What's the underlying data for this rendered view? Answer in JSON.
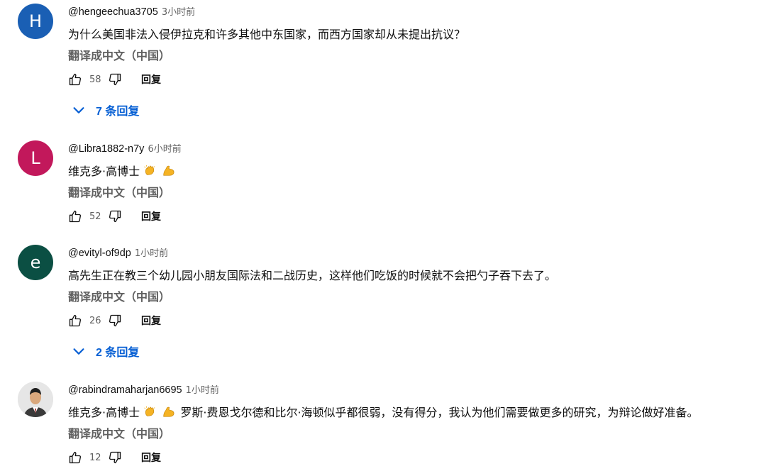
{
  "comments": [
    {
      "avatar_letter": "H",
      "avatar_color": "#1a5fb4",
      "author": "@hengeechua3705",
      "time": "3小时前",
      "text": "为什么美国非法入侵伊拉克和许多其他中东国家，而西方国家却从未提出抗议？",
      "translate": "翻译成中文（中国）",
      "likes": "58",
      "reply": "回复",
      "replies_label": "7 条回复"
    },
    {
      "avatar_letter": "L",
      "avatar_color": "#c2185b",
      "author": "@Libra1882-n7y",
      "time": "6小时前",
      "text": "维克多·高博士",
      "emojis": [
        "clapping-hands-emoji",
        "flexed-biceps-emoji"
      ],
      "translate": "翻译成中文（中国）",
      "likes": "52",
      "reply": "回复"
    },
    {
      "avatar_letter": "e",
      "avatar_color": "#0b4f43",
      "author": "@evityl-of9dp",
      "time": "1小时前",
      "text": "高先生正在教三个幼儿园小朋友国际法和二战历史，这样他们吃饭的时候就不会把勺子吞下去了。",
      "translate": "翻译成中文（中国）",
      "likes": "26",
      "reply": "回复",
      "replies_label": "2 条回复"
    },
    {
      "avatar_letter": "",
      "avatar_color": "#d9d9d9",
      "author": "@rabindramaharjan6695",
      "time": "1小时前",
      "text_before": "维克多·高博士",
      "text_after": "罗斯·费恩戈尔德和比尔·海顿似乎都很弱，没有得分，我认为他们需要做更多的研究，为辩论做好准备。",
      "emojis": [
        "clapping-hands-emoji",
        "flexed-biceps-emoji"
      ],
      "translate": "翻译成中文（中国）",
      "likes": "12",
      "reply": "回复"
    }
  ]
}
